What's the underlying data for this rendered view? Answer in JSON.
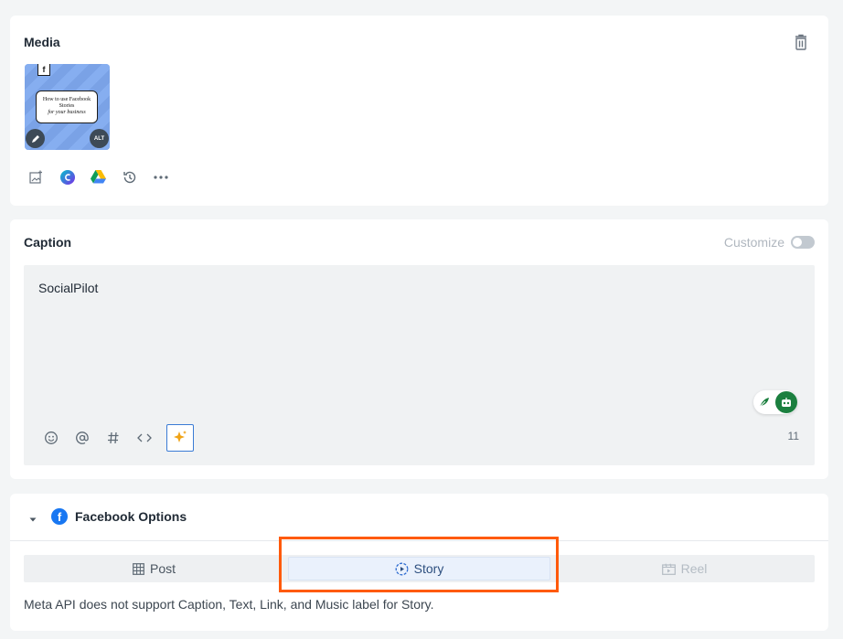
{
  "media": {
    "title": "Media",
    "thumbnail": {
      "headline": "How to use Facebook Stories",
      "subline": "for your business",
      "fb_letter": "f",
      "alt_label": "ALT"
    },
    "tools": [
      "add-image-icon",
      "canva-icon",
      "google-drive-icon",
      "history-icon",
      "more-icon"
    ]
  },
  "caption": {
    "title": "Caption",
    "customize_label": "Customize",
    "customize_on": false,
    "text": "SocialPilot",
    "char_count": "11",
    "toolbar": [
      "emoji-icon",
      "mention-icon",
      "hashtag-icon",
      "code-icon",
      "ai-sparkle-icon"
    ]
  },
  "facebook": {
    "title": "Facebook Options",
    "tabs": [
      {
        "label": "Post",
        "icon": "grid-icon",
        "state": "default"
      },
      {
        "label": "Story",
        "icon": "play-circle-icon",
        "state": "active"
      },
      {
        "label": "Reel",
        "icon": "reel-icon",
        "state": "disabled"
      }
    ],
    "note": "Meta API does not support Caption, Text, Link, and Music label for Story."
  },
  "colors": {
    "accent": "#1877f2",
    "highlight": "#ff5a0a",
    "ai_green": "#1b7f3f"
  }
}
